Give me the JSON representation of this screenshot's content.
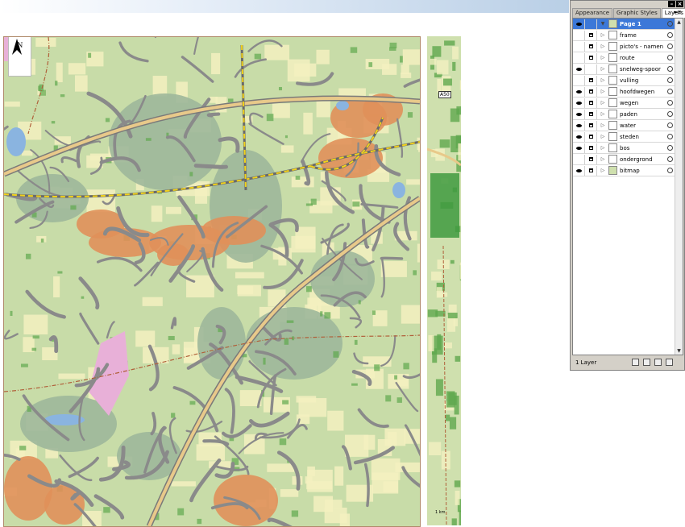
{
  "map": {
    "north_label": "N",
    "highway_label": "A50",
    "scale_label": "1 km",
    "colors": {
      "land": "#c8dca8",
      "field": "#f3f0c0",
      "forest": "#9db79a",
      "urban": "#e0905a",
      "road": "#8a8a8a",
      "highway": "#e8c98a",
      "rail": "#f2d21a",
      "water": "#8ab4e0",
      "industrial": "#e8b0d8",
      "border": "#b0603a"
    }
  },
  "panel": {
    "tabs": [
      {
        "label": "Appearance"
      },
      {
        "label": "Graphic Styles"
      },
      {
        "label": "Layers"
      }
    ],
    "menu_icon": "panel-menu-icon",
    "layers": [
      {
        "name": "Page 1",
        "visible": true,
        "locked": false,
        "selected": true,
        "expanded": true
      },
      {
        "name": "frame",
        "visible": false,
        "locked": true
      },
      {
        "name": "picto's - namen",
        "visible": false,
        "locked": true
      },
      {
        "name": "route",
        "visible": false,
        "locked": true
      },
      {
        "name": "snelweg-spoor",
        "visible": true,
        "locked": false
      },
      {
        "name": "vulling",
        "visible": false,
        "locked": true
      },
      {
        "name": "hoofdwegen",
        "visible": true,
        "locked": true
      },
      {
        "name": "wegen",
        "visible": true,
        "locked": true
      },
      {
        "name": "paden",
        "visible": true,
        "locked": true
      },
      {
        "name": "water",
        "visible": true,
        "locked": true
      },
      {
        "name": "steden",
        "visible": true,
        "locked": true
      },
      {
        "name": "bos",
        "visible": true,
        "locked": true
      },
      {
        "name": "ondergrond",
        "visible": false,
        "locked": true
      },
      {
        "name": "bitmap",
        "visible": true,
        "locked": true
      }
    ],
    "footer_count": "1 Layer"
  }
}
